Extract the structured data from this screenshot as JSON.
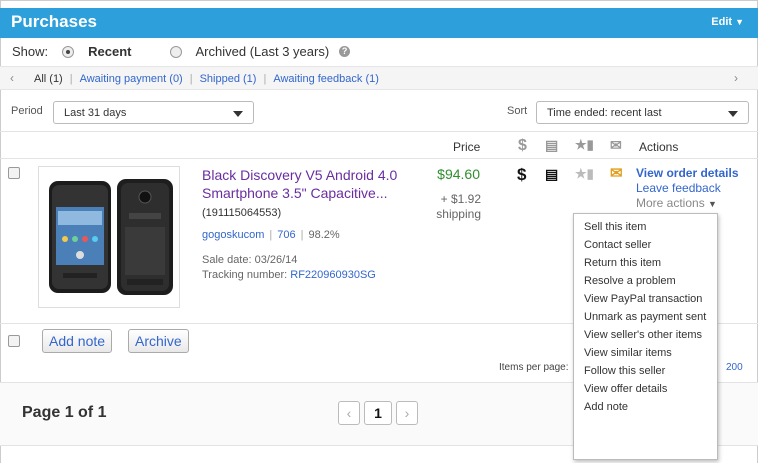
{
  "header": {
    "title": "Purchases",
    "edit": "Edit"
  },
  "show": {
    "label": "Show:",
    "recent": "Recent",
    "archived": "Archived (Last 3 years)",
    "help": "?"
  },
  "tabs": [
    {
      "label": "All (1)"
    },
    {
      "label": "Awaiting payment (0)"
    },
    {
      "label": "Shipped (1)"
    },
    {
      "label": "Awaiting feedback (1)"
    }
  ],
  "period": {
    "label": "Period",
    "value": "Last 31 days"
  },
  "sort": {
    "label": "Sort",
    "value": "Time ended: recent last"
  },
  "columns": {
    "price": "Price",
    "actions": "Actions"
  },
  "item": {
    "title": "Black Discovery V5 Android 4.0 Smartphone 3.5\" Capacitive...",
    "id": "(191115064553)",
    "seller": "gogoskucom",
    "feedback_score": "706",
    "feedback_pct": "98.2%",
    "sale_date": "Sale date: 03/26/14",
    "tracking_label": "Tracking number:",
    "tracking_number": "RF220960930SG",
    "price": "$94.60",
    "shipping": "+ $1.92 shipping"
  },
  "actions": {
    "view_order": "View order details",
    "leave_feedback": "Leave feedback",
    "more": "More actions"
  },
  "buttons": {
    "add_note": "Add note",
    "archive": "Archive"
  },
  "items_per_page": {
    "label": "Items per page:",
    "value": "200"
  },
  "pagination": {
    "label": "Page 1 of 1",
    "current": "1",
    "prev": "‹",
    "next": "›"
  },
  "more_actions_menu": [
    "Sell this item",
    "Contact seller",
    "Return this item",
    "Resolve a problem",
    "View PayPal transaction",
    "Unmark as payment sent",
    "View seller's other items",
    "View similar items",
    "Follow this seller",
    "View offer details",
    "Add note"
  ],
  "colors": {
    "header_bg": "#2d9fda",
    "link": "#3366cc",
    "price": "#2f8f2f",
    "title": "#6a2da0"
  }
}
